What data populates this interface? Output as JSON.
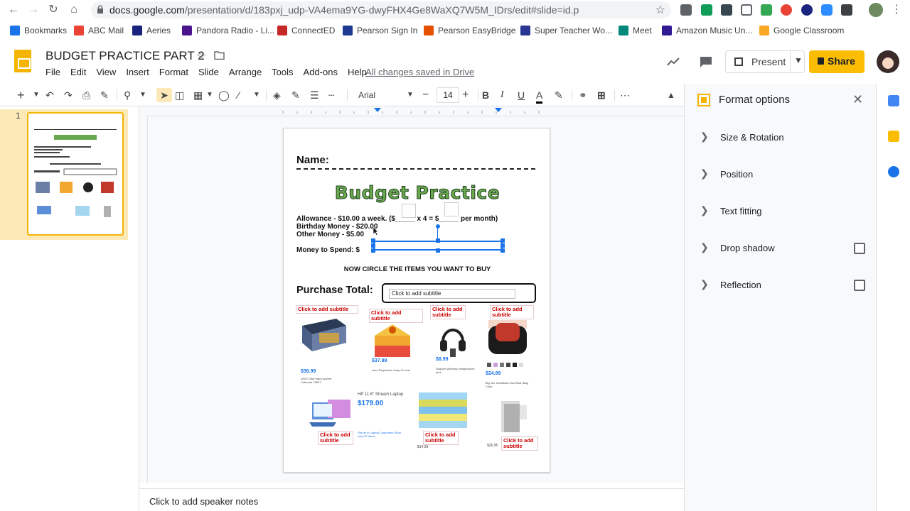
{
  "browser": {
    "url_host": "docs.google.com",
    "url_path": "/presentation/d/183pxj_udp-VA4ema9YG-dwyFHX4Ge8WaXQ7W5M_IDrs/edit#slide=id.p"
  },
  "bookmarks": [
    {
      "label": "Bookmarks",
      "color": "#1a73e8"
    },
    {
      "label": "ABC Mail",
      "color": "#ea4335"
    },
    {
      "label": "Aeries",
      "color": "#1a237e"
    },
    {
      "label": "Pandora Radio - Li...",
      "color": "#4a148c"
    },
    {
      "label": "ConnectED",
      "color": "#c62828"
    },
    {
      "label": "Pearson Sign In",
      "color": "#1f3a93"
    },
    {
      "label": "Pearson EasyBridge",
      "color": "#e65100"
    },
    {
      "label": "Super Teacher Wo...",
      "color": "#283593"
    },
    {
      "label": "Meet",
      "color": "#00897b"
    },
    {
      "label": "Amazon Music Un...",
      "color": "#311b92"
    },
    {
      "label": "Google Classroom",
      "color": "#f9a825"
    }
  ],
  "doc": {
    "title": "BUDGET PRACTICE PART 2",
    "saved_status": "All changes saved in Drive",
    "menu": [
      "File",
      "Edit",
      "View",
      "Insert",
      "Format",
      "Slide",
      "Arrange",
      "Tools",
      "Add-ons",
      "Help"
    ],
    "present_label": "Present",
    "share_label": "Share"
  },
  "toolbar": {
    "font": "Arial",
    "font_size": "14"
  },
  "filmstrip": {
    "slide_number": "1"
  },
  "slide": {
    "name_label": "Name:",
    "title": "Budget Practice",
    "allowance": "Allowance - $10.00 a week. ($_____ x 4 = $_____ per month)",
    "birthday": "Birthday Money - $20.00",
    "other": "Other Money - $5.00",
    "money_to_spend": "Money to Spend: $",
    "circle_instruction": "NOW CIRCLE THE ITEMS YOU WANT TO BUY",
    "purchase_total": "Purchase Total:",
    "subtitle_placeholder": "Click to add subtitle",
    "caption_placeholder": "Click to add subtitle",
    "products": [
      {
        "price": "$39.99",
        "desc": "LEGO Star Wars Advent Calendar 75097"
      },
      {
        "price": "$37.99",
        "desc": "Intex Playhouse Jump-O-Lene"
      },
      {
        "price": "$8.99",
        "desc": "Sharper Wireless Headphones and..."
      },
      {
        "price": "$24.99",
        "desc": "Big Joe SmartMax Duo Bean Bag Chair"
      },
      {
        "price": "$179.00",
        "desc": "HP 11.6\" Stream Laptop"
      },
      {
        "price": "$14.99",
        "desc": ""
      },
      {
        "price": "$26.95",
        "desc": ""
      }
    ],
    "laptop_title": "HP 11.6\" Stream Laptop",
    "laptop_links": "See all in Laptop Computers  Shop only HP items"
  },
  "notes": {
    "placeholder": "Click to add speaker notes"
  },
  "format_panel": {
    "title": "Format options",
    "sections": [
      {
        "label": "Size & Rotation",
        "has_checkbox": false
      },
      {
        "label": "Position",
        "has_checkbox": false
      },
      {
        "label": "Text fitting",
        "has_checkbox": false
      },
      {
        "label": "Drop shadow",
        "has_checkbox": true
      },
      {
        "label": "Reflection",
        "has_checkbox": true
      }
    ]
  },
  "colors": {
    "accent": "#1a73e8",
    "slides_yellow": "#f4b400",
    "share_yellow": "#fbbc04",
    "title_green": "#6aa84f",
    "caption_red": "#cc0000"
  },
  "icons": {
    "back": "arrow-left",
    "forward": "arrow-right",
    "reload": "reload",
    "home": "home",
    "lock": "lock",
    "bookmark_star": "star",
    "trend": "trend",
    "comment": "comment",
    "close": "close",
    "chevron": "chevron-right"
  }
}
